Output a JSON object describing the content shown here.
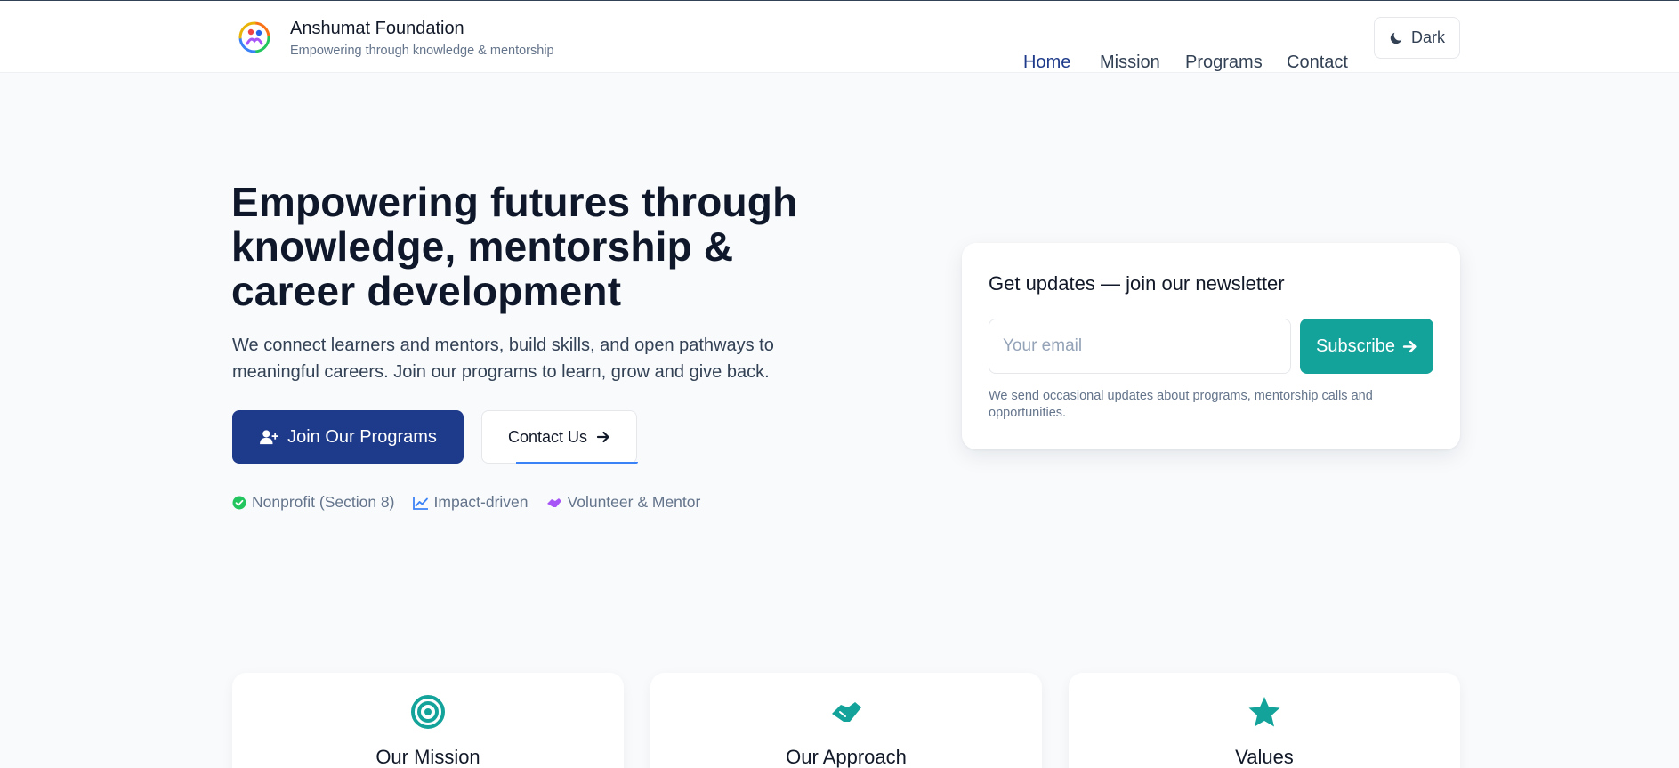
{
  "header": {
    "brand_title": "Anshumat Foundation",
    "brand_tagline": "Empowering through knowledge & mentorship",
    "nav": [
      {
        "label": "Home",
        "active": true
      },
      {
        "label": "Mission",
        "active": false
      },
      {
        "label": "Programs",
        "active": false
      },
      {
        "label": "Contact",
        "active": false
      }
    ],
    "theme_toggle_label": "Dark",
    "theme_toggle_icon": "moon-icon"
  },
  "hero": {
    "title": "Empowering futures through knowledge, mentorship & career development",
    "subtitle": "We connect learners and mentors, build skills, and open pathways to meaningful careers. Join our programs to learn, grow and give back.",
    "primary_button": {
      "label": "Join Our Programs",
      "icon": "user-plus-icon"
    },
    "secondary_button": {
      "label": "Contact Us",
      "icon": "arrow-right-icon"
    },
    "badges": [
      {
        "label": "Nonprofit (Section 8)",
        "icon": "check-circle-icon",
        "color": "#22c55e"
      },
      {
        "label": "Impact-driven",
        "icon": "chart-line-icon",
        "color": "#3b82f6"
      },
      {
        "label": "Volunteer & Mentor",
        "icon": "handshake-icon",
        "color": "#a855f7"
      }
    ]
  },
  "newsletter": {
    "title": "Get updates — join our newsletter",
    "email_placeholder": "Your email",
    "email_value": "",
    "subscribe_label": "Subscribe",
    "note": "We send occasional updates about programs, mentorship calls and opportunities."
  },
  "features": [
    {
      "title": "Our Mission",
      "icon": "bullseye-icon"
    },
    {
      "title": "Our Approach",
      "icon": "handshake-icon"
    },
    {
      "title": "Values",
      "icon": "star-icon"
    }
  ],
  "colors": {
    "primary": "#1e3a8a",
    "accent": "#14a39a",
    "text": "#0f172a",
    "muted": "#64748b"
  }
}
